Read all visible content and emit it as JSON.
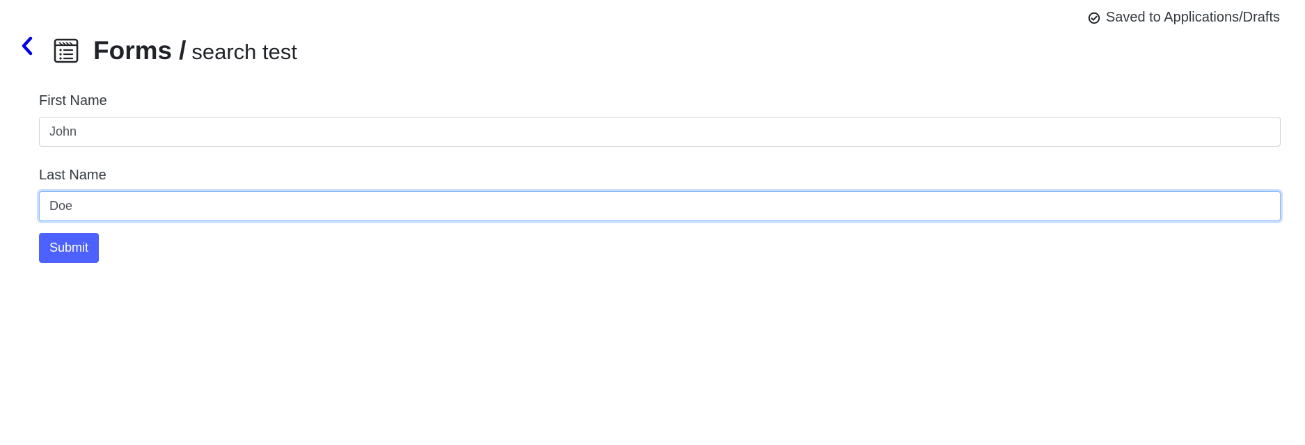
{
  "status": {
    "saved_text": "Saved to Applications/Drafts",
    "icon": "check-circle-icon"
  },
  "header": {
    "back_icon": "chevron-left-icon",
    "form_icon": "form-document-icon",
    "title": "Forms",
    "separator": "/",
    "subtitle": "search test"
  },
  "form": {
    "first_name": {
      "label": "First Name",
      "value": "John"
    },
    "last_name": {
      "label": "Last Name",
      "value": "Doe"
    },
    "submit_label": "Submit"
  },
  "colors": {
    "accent": "#4c61fd",
    "back_icon": "#0000ee",
    "focus_border": "#86b7fe"
  }
}
